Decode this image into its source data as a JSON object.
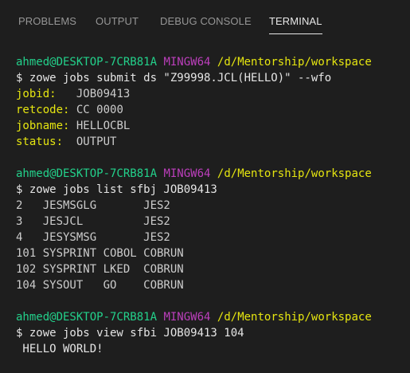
{
  "tabs": [
    {
      "label": "PROBLEMS",
      "active": false
    },
    {
      "label": "OUTPUT",
      "active": false
    },
    {
      "label": "DEBUG CONSOLE",
      "active": false
    },
    {
      "label": "TERMINAL",
      "active": true
    }
  ],
  "prompt": {
    "user_host": "ahmed@DESKTOP-7CRB81A",
    "shell": "MINGW64",
    "path": "/d/Mentorship/workspace"
  },
  "blocks": [
    {
      "command": "$ zowe jobs submit ds \"Z99998.JCL(HELLO)\" --wfo",
      "fields": [
        {
          "key": "jobid:",
          "pad": "   ",
          "value": "JOB09413"
        },
        {
          "key": "retcode:",
          "pad": " ",
          "value": "CC 0000"
        },
        {
          "key": "jobname:",
          "pad": " ",
          "value": "HELLOCBL"
        },
        {
          "key": "status:",
          "pad": "  ",
          "value": "OUTPUT"
        }
      ]
    },
    {
      "command": "$ zowe jobs list sfbj JOB09413",
      "rows": [
        "2   JESMSGLG       JES2",
        "3   JESJCL         JES2",
        "4   JESYSMSG       JES2",
        "101 SYSPRINT COBOL COBRUN",
        "102 SYSPRINT LKED  COBRUN",
        "104 SYSOUT   GO    COBRUN"
      ]
    },
    {
      "command": "$ zowe jobs view sfbi JOB09413 104",
      "output": " HELLO WORLD!"
    }
  ],
  "colors": {
    "background": "#1e1e1e",
    "prompt_user": "#23d18b",
    "prompt_shell": "#bc3fbc",
    "prompt_path": "#e5e510",
    "text": "#cccccc",
    "tab_inactive": "#969696",
    "tab_active": "#e7e7e7"
  }
}
